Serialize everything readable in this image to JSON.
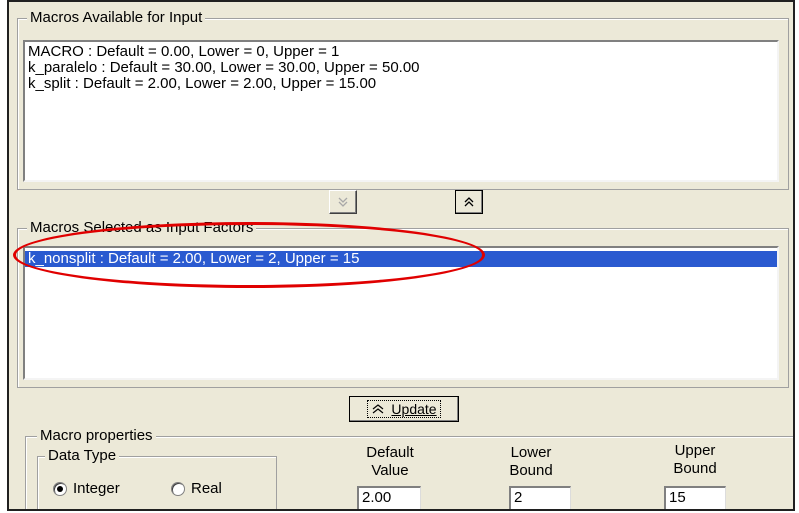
{
  "available": {
    "legend": "Macros Available for Input",
    "items": [
      "MACRO : Default = 0.00, Lower = 0, Upper = 1",
      "k_paralelo : Default = 30.00, Lower = 30.00, Upper = 50.00",
      "k_split : Default = 2.00, Lower = 2.00, Upper = 15.00"
    ]
  },
  "transfer": {
    "move_down_icon": "double-chevron-down",
    "move_up_icon": "double-chevron-up"
  },
  "selected": {
    "legend": "Macros Selected as Input Factors",
    "items": [
      "k_nonsplit : Default = 2.00, Lower = 2, Upper = 15"
    ],
    "highlight_color": "#e00000"
  },
  "update_button": {
    "label": "Update",
    "icon": "double-chevron-up"
  },
  "properties": {
    "legend": "Macro properties",
    "data_type": {
      "legend": "Data Type",
      "options": [
        "Integer",
        "Real"
      ],
      "selected": "Integer"
    },
    "default_label_1": "Default",
    "default_label_2": "Value",
    "default_value": "2.00",
    "lower_label_1": "Lower",
    "lower_label_2": "Bound",
    "lower_value": "2",
    "upper_label_1": "Upper",
    "upper_label_2": "Bound",
    "upper_value": "15"
  },
  "colors": {
    "selection": "#2a5ad0",
    "face": "#ece9d8"
  }
}
